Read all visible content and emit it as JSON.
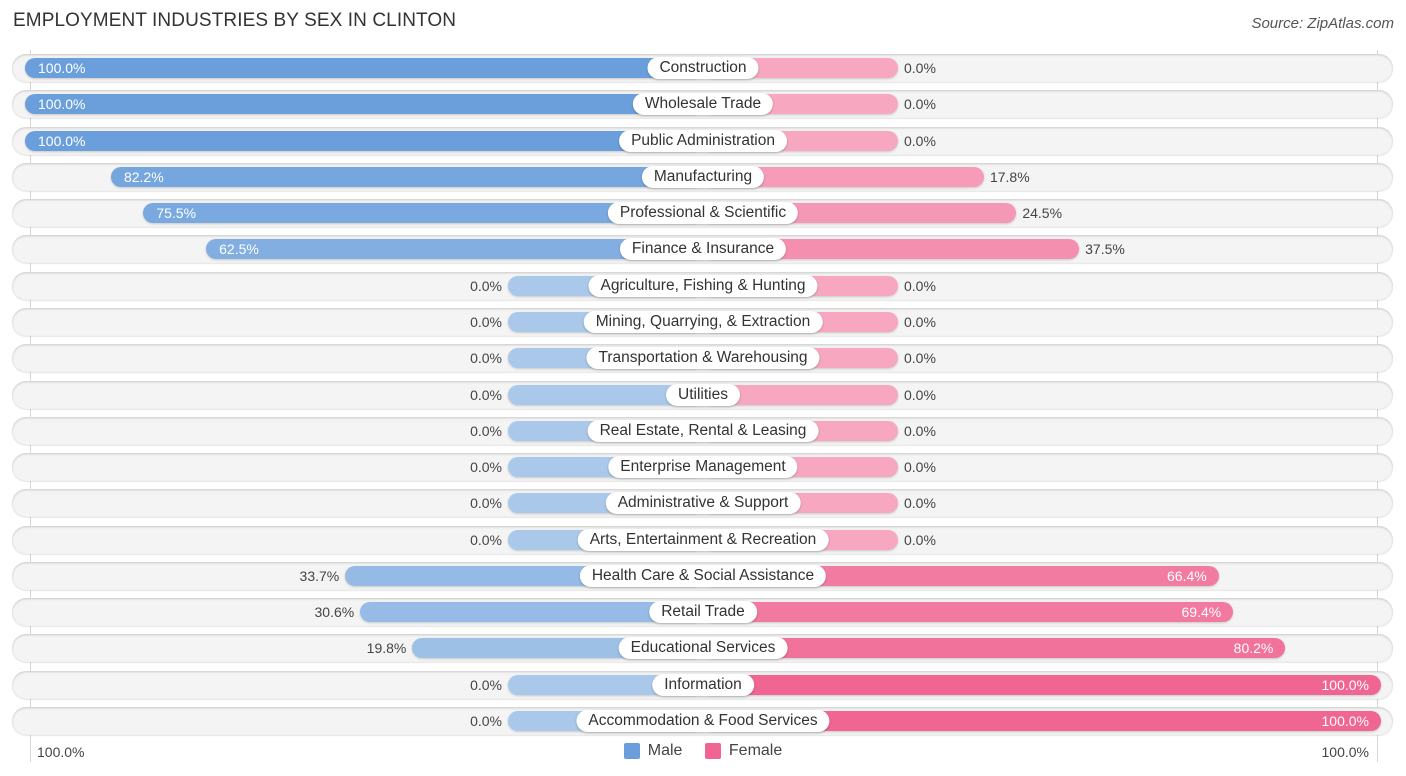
{
  "chart_data": {
    "type": "bar",
    "orientation": "horizontal-diverging",
    "title": "EMPLOYMENT INDUSTRIES BY SEX IN CLINTON",
    "source": "Source: ZipAtlas.com",
    "categories": [
      "Construction",
      "Wholesale Trade",
      "Public Administration",
      "Manufacturing",
      "Professional & Scientific",
      "Finance & Insurance",
      "Agriculture, Fishing & Hunting",
      "Mining, Quarrying, & Extraction",
      "Transportation & Warehousing",
      "Utilities",
      "Real Estate, Rental & Leasing",
      "Enterprise Management",
      "Administrative & Support",
      "Arts, Entertainment & Recreation",
      "Health Care & Social Assistance",
      "Retail Trade",
      "Educational Services",
      "Information",
      "Accommodation & Food Services"
    ],
    "series": [
      {
        "name": "Male",
        "color": "#6a9fdc",
        "color_light": "#a9c8ea",
        "values": [
          100.0,
          100.0,
          100.0,
          82.2,
          75.5,
          62.5,
          0.0,
          0.0,
          0.0,
          0.0,
          0.0,
          0.0,
          0.0,
          0.0,
          33.7,
          30.6,
          19.8,
          0.0,
          0.0
        ],
        "labels": [
          "100.0%",
          "100.0%",
          "100.0%",
          "82.2%",
          "75.5%",
          "62.5%",
          "0.0%",
          "0.0%",
          "0.0%",
          "0.0%",
          "0.0%",
          "0.0%",
          "0.0%",
          "0.0%",
          "33.7%",
          "30.6%",
          "19.8%",
          "0.0%",
          "0.0%"
        ]
      },
      {
        "name": "Female",
        "color": "#f06592",
        "color_light": "#f7a8c0",
        "values": [
          0.0,
          0.0,
          0.0,
          17.8,
          24.5,
          37.5,
          0.0,
          0.0,
          0.0,
          0.0,
          0.0,
          0.0,
          0.0,
          0.0,
          66.4,
          69.4,
          80.2,
          100.0,
          100.0
        ],
        "labels": [
          "0.0%",
          "0.0%",
          "0.0%",
          "17.8%",
          "24.5%",
          "37.5%",
          "0.0%",
          "0.0%",
          "0.0%",
          "0.0%",
          "0.0%",
          "0.0%",
          "0.0%",
          "0.0%",
          "66.4%",
          "69.4%",
          "80.2%",
          "100.0%",
          "100.0%"
        ]
      }
    ],
    "xlim": [
      0,
      100
    ],
    "axis_left_label": "100.0%",
    "axis_right_label": "100.0%",
    "legend": [
      {
        "label": "Male",
        "color": "#6a9fdc"
      },
      {
        "label": "Female",
        "color": "#f06592"
      }
    ],
    "legend_position": "bottom-center",
    "grid": false
  }
}
